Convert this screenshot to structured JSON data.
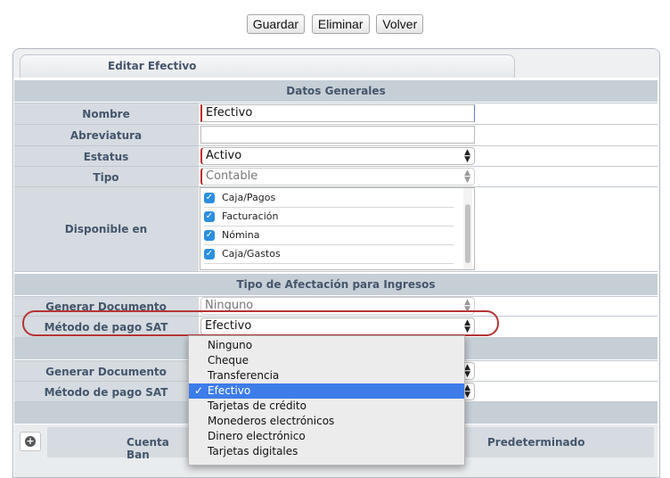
{
  "toolbar": {
    "save": "Guardar",
    "delete": "Eliminar",
    "back": "Volver"
  },
  "tab": {
    "title": "Editar Efectivo"
  },
  "datos_generales": {
    "section_title": "Datos Generales",
    "nombre": {
      "label": "Nombre",
      "value": "Efectivo"
    },
    "abreviatura": {
      "label": "Abreviatura",
      "value": ""
    },
    "estatus": {
      "label": "Estatus",
      "value": "Activo"
    },
    "tipo": {
      "label": "Tipo",
      "value": "Contable"
    },
    "disponible": {
      "label": "Disponible en",
      "items": [
        {
          "label": "Caja/Pagos",
          "checked": true
        },
        {
          "label": "Facturación",
          "checked": true
        },
        {
          "label": "Nómina",
          "checked": true
        },
        {
          "label": "Caja/Gastos",
          "checked": true
        }
      ]
    }
  },
  "ingresos": {
    "section_title": "Tipo de Afectación para Ingresos",
    "generar_documento": {
      "label": "Generar Documento",
      "value": "Ninguno"
    },
    "metodo_pago": {
      "label": "Método de pago SAT",
      "value": "Efectivo"
    }
  },
  "egresos": {
    "generar_documento": {
      "label": "Generar Documento"
    },
    "metodo_pago": {
      "label": "Método de pago SAT"
    }
  },
  "dropdown": {
    "options": [
      "Ninguno",
      "Cheque",
      "Transferencia",
      "Efectivo",
      "Tarjetas de crédito",
      "Monederos electrónicos",
      "Dinero electrónico",
      "Tarjetas digitales"
    ],
    "selected_index": 3,
    "check_glyph": "✓"
  },
  "bank_table": {
    "add_icon": "plus-circle-icon",
    "col_account": "Cuenta Ban",
    "col_default": "Predeterminado"
  },
  "colors": {
    "accent": "#3d7ce9",
    "highlight": "#b53535",
    "label": "#45556b",
    "header": "#c6cfd6"
  }
}
